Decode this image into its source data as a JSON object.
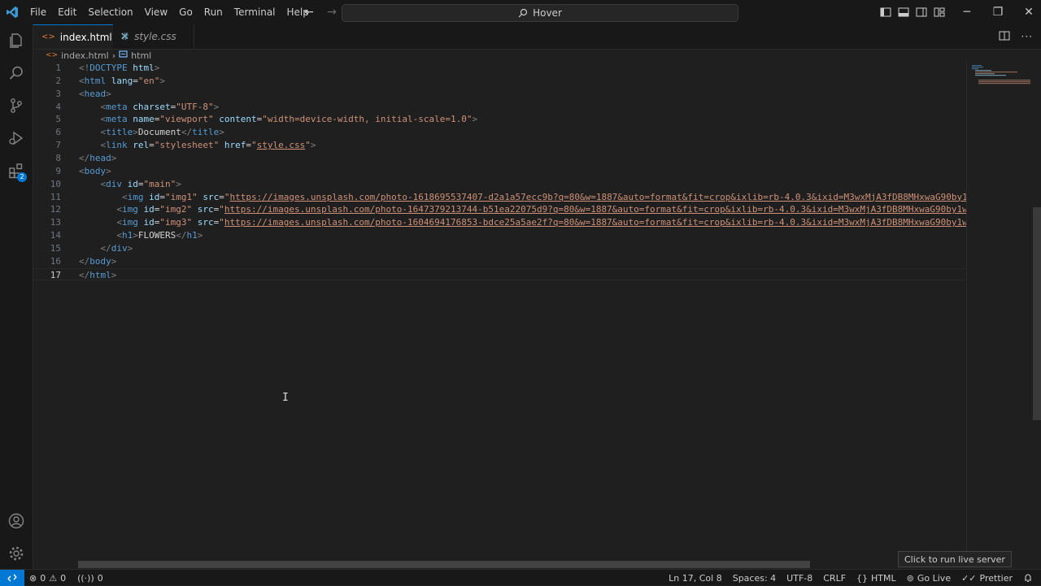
{
  "menu": [
    "File",
    "Edit",
    "Selection",
    "View",
    "Go",
    "Run",
    "Terminal",
    "Help"
  ],
  "command_center": {
    "label": "Hover"
  },
  "tabs": [
    {
      "label": "index.html",
      "close": "✕"
    },
    {
      "label": "style.css"
    }
  ],
  "breadcrumb": {
    "file": "index.html",
    "separator": "›",
    "symbol": "html"
  },
  "activity_badge": "2",
  "code_lines": [
    {
      "n": "1",
      "tokens": [
        [
          "br",
          "<!"
        ],
        [
          "tag",
          "DOCTYPE"
        ],
        [
          "text",
          " "
        ],
        [
          "attr",
          "html"
        ],
        [
          "br",
          ">"
        ]
      ]
    },
    {
      "n": "2",
      "tokens": [
        [
          "br",
          "<"
        ],
        [
          "tag",
          "html"
        ],
        [
          "text",
          " "
        ],
        [
          "attr",
          "lang"
        ],
        [
          "text",
          "="
        ],
        [
          "str",
          "\"en\""
        ],
        [
          "br",
          ">"
        ]
      ]
    },
    {
      "n": "3",
      "tokens": [
        [
          "br",
          "<"
        ],
        [
          "tag",
          "head"
        ],
        [
          "br",
          ">"
        ]
      ]
    },
    {
      "n": "4",
      "tokens": [
        [
          "text",
          "    "
        ],
        [
          "br",
          "<"
        ],
        [
          "tag",
          "meta"
        ],
        [
          "text",
          " "
        ],
        [
          "attr",
          "charset"
        ],
        [
          "text",
          "="
        ],
        [
          "str",
          "\"UTF-8\""
        ],
        [
          "br",
          ">"
        ]
      ]
    },
    {
      "n": "5",
      "tokens": [
        [
          "text",
          "    "
        ],
        [
          "br",
          "<"
        ],
        [
          "tag",
          "meta"
        ],
        [
          "text",
          " "
        ],
        [
          "attr",
          "name"
        ],
        [
          "text",
          "="
        ],
        [
          "str",
          "\"viewport\""
        ],
        [
          "text",
          " "
        ],
        [
          "attr",
          "content"
        ],
        [
          "text",
          "="
        ],
        [
          "str",
          "\"width=device-width, initial-scale=1.0\""
        ],
        [
          "br",
          ">"
        ]
      ]
    },
    {
      "n": "6",
      "tokens": [
        [
          "text",
          "    "
        ],
        [
          "br",
          "<"
        ],
        [
          "tag",
          "title"
        ],
        [
          "br",
          ">"
        ],
        [
          "text",
          "Document"
        ],
        [
          "br",
          "</"
        ],
        [
          "tag",
          "title"
        ],
        [
          "br",
          ">"
        ]
      ]
    },
    {
      "n": "7",
      "tokens": [
        [
          "text",
          "    "
        ],
        [
          "br",
          "<"
        ],
        [
          "tag",
          "link"
        ],
        [
          "text",
          " "
        ],
        [
          "attr",
          "rel"
        ],
        [
          "text",
          "="
        ],
        [
          "str",
          "\"stylesheet\""
        ],
        [
          "text",
          " "
        ],
        [
          "attr",
          "href"
        ],
        [
          "text",
          "="
        ],
        [
          "str",
          "\""
        ],
        [
          "link",
          "style.css"
        ],
        [
          "str",
          "\""
        ],
        [
          "br",
          ">"
        ]
      ]
    },
    {
      "n": "8",
      "tokens": [
        [
          "br",
          "</"
        ],
        [
          "tag",
          "head"
        ],
        [
          "br",
          ">"
        ]
      ]
    },
    {
      "n": "9",
      "tokens": [
        [
          "br",
          "<"
        ],
        [
          "tag",
          "body"
        ],
        [
          "br",
          ">"
        ]
      ]
    },
    {
      "n": "10",
      "tokens": [
        [
          "text",
          "    "
        ],
        [
          "br",
          "<"
        ],
        [
          "tag",
          "div"
        ],
        [
          "text",
          " "
        ],
        [
          "attr",
          "id"
        ],
        [
          "text",
          "="
        ],
        [
          "str",
          "\"main\""
        ],
        [
          "br",
          ">"
        ]
      ]
    },
    {
      "n": "11",
      "tokens": [
        [
          "text",
          "        "
        ],
        [
          "br",
          "<"
        ],
        [
          "tag",
          "img"
        ],
        [
          "text",
          " "
        ],
        [
          "attr",
          "id"
        ],
        [
          "text",
          "="
        ],
        [
          "str",
          "\"img1\""
        ],
        [
          "text",
          " "
        ],
        [
          "attr",
          "src"
        ],
        [
          "text",
          "="
        ],
        [
          "str",
          "\""
        ],
        [
          "link",
          "https://images.unsplash.com/photo-1618695537407-d2a1a57ecc9b?q=80&w=1887&auto=format&fit=crop&ixlib=rb-4.0.3&ixid=M3wxMjA3fDB8MHxwaG90by1wYWdl"
        ]
      ]
    },
    {
      "n": "12",
      "tokens": [
        [
          "text",
          "       "
        ],
        [
          "br",
          "<"
        ],
        [
          "tag",
          "img"
        ],
        [
          "text",
          " "
        ],
        [
          "attr",
          "id"
        ],
        [
          "text",
          "="
        ],
        [
          "str",
          "\"img2\""
        ],
        [
          "text",
          " "
        ],
        [
          "attr",
          "src"
        ],
        [
          "text",
          "="
        ],
        [
          "str",
          "\""
        ],
        [
          "link",
          "https://images.unsplash.com/photo-1647379213744-b51ea22075d9?q=80&w=1887&auto=format&fit=crop&ixlib=rb-4.0.3&ixid=M3wxMjA3fDB8MHxwaG90by1wYWdlf"
        ]
      ]
    },
    {
      "n": "13",
      "tokens": [
        [
          "text",
          "       "
        ],
        [
          "br",
          "<"
        ],
        [
          "tag",
          "img"
        ],
        [
          "text",
          " "
        ],
        [
          "attr",
          "id"
        ],
        [
          "text",
          "="
        ],
        [
          "str",
          "\"img3\""
        ],
        [
          "text",
          " "
        ],
        [
          "attr",
          "src"
        ],
        [
          "text",
          "="
        ],
        [
          "str",
          "\""
        ],
        [
          "link",
          "https://images.unsplash.com/photo-1604694176853-bdce25a5ae2f?q=80&w=1887&auto=format&fit=crop&ixlib=rb-4.0.3&ixid=M3wxMjA3fDB8MHxwaG90by1wYWdlf"
        ]
      ]
    },
    {
      "n": "14",
      "tokens": [
        [
          "text",
          "       "
        ],
        [
          "br",
          "<"
        ],
        [
          "tag",
          "h1"
        ],
        [
          "br",
          ">"
        ],
        [
          "text",
          "FLOWERS"
        ],
        [
          "br",
          "</"
        ],
        [
          "tag",
          "h1"
        ],
        [
          "br",
          ">"
        ]
      ]
    },
    {
      "n": "15",
      "tokens": [
        [
          "text",
          "    "
        ],
        [
          "br",
          "</"
        ],
        [
          "tag",
          "div"
        ],
        [
          "br",
          ">"
        ]
      ]
    },
    {
      "n": "16",
      "tokens": [
        [
          "br",
          "</"
        ],
        [
          "tag",
          "body"
        ],
        [
          "br",
          ">"
        ]
      ]
    },
    {
      "n": "17",
      "tokens": [
        [
          "br",
          "</"
        ],
        [
          "tag",
          "html"
        ],
        [
          "br",
          ">"
        ]
      ],
      "current": true
    }
  ],
  "status": {
    "errors": "0",
    "warnings": "0",
    "ports": "0",
    "position": "Ln 17, Col 8",
    "spaces": "Spaces: 4",
    "encoding": "UTF-8",
    "eol": "CRLF",
    "language": "HTML",
    "go_live": "Go Live",
    "prettier": "Prettier"
  },
  "tooltip": "Click to run live server",
  "colors": {
    "accent": "#0078d4",
    "tag": "#569cd6",
    "attr": "#9cdcfe",
    "string": "#ce9178"
  }
}
